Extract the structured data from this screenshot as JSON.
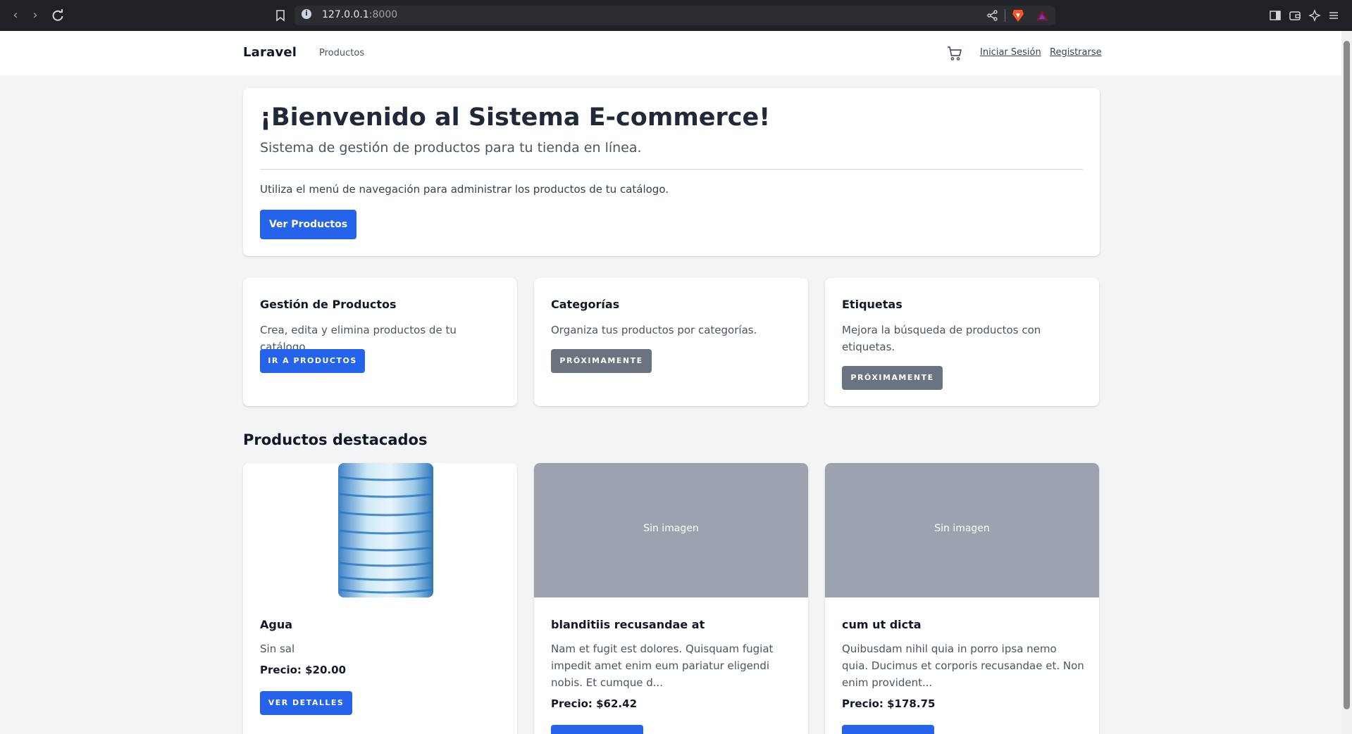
{
  "browser": {
    "url_host": "127.0.0.1",
    "url_port": ":8000"
  },
  "nav": {
    "brand": "Laravel",
    "products_link": "Productos",
    "login": "Iniciar Sesión",
    "register": "Registrarse",
    "cart_icon": "cart-icon"
  },
  "welcome": {
    "title": "¡Bienvenido al Sistema E-commerce!",
    "subtitle": "Sistema de gestión de productos para tu tienda en línea.",
    "description": "Utiliza el menú de navegación para administrar los productos de tu catálogo.",
    "button": "Ver Productos"
  },
  "features": [
    {
      "title": "Gestión de Productos",
      "text": "Crea, edita y elimina productos de tu catálogo.",
      "button": "IR A PRODUCTOS"
    },
    {
      "title": "Categorías",
      "text": "Organiza tus productos por categorías.",
      "button": "PRÓXIMAMENTE"
    },
    {
      "title": "Etiquetas",
      "text": "Mejora la búsqueda de productos con etiquetas.",
      "button": "PRÓXIMAMENTE"
    }
  ],
  "featured": {
    "title": "Productos destacados",
    "products": [
      {
        "name": "Agua",
        "description": "Sin sal",
        "price": "Precio: $20.00",
        "button": "VER DETALLES",
        "image": "water-bottle"
      },
      {
        "name": "blanditiis recusandae at",
        "description": "Nam et fugit est dolores. Quisquam fugiat impedit amet enim eum pariatur eligendi nobis. Et cumque d...",
        "price": "Precio: $62.42",
        "placeholder": "Sin imagen"
      },
      {
        "name": "cum ut dicta",
        "description": "Quibusdam nihil quia in porro ipsa nemo quia. Ducimus et corporis recusandae et. Non enim provident...",
        "price": "Precio: $178.75",
        "placeholder": "Sin imagen"
      }
    ]
  },
  "colors": {
    "primary": "#2563eb",
    "secondary": "#6b7280",
    "background": "#f3f4f6",
    "placeholder": "#9ca3af"
  }
}
